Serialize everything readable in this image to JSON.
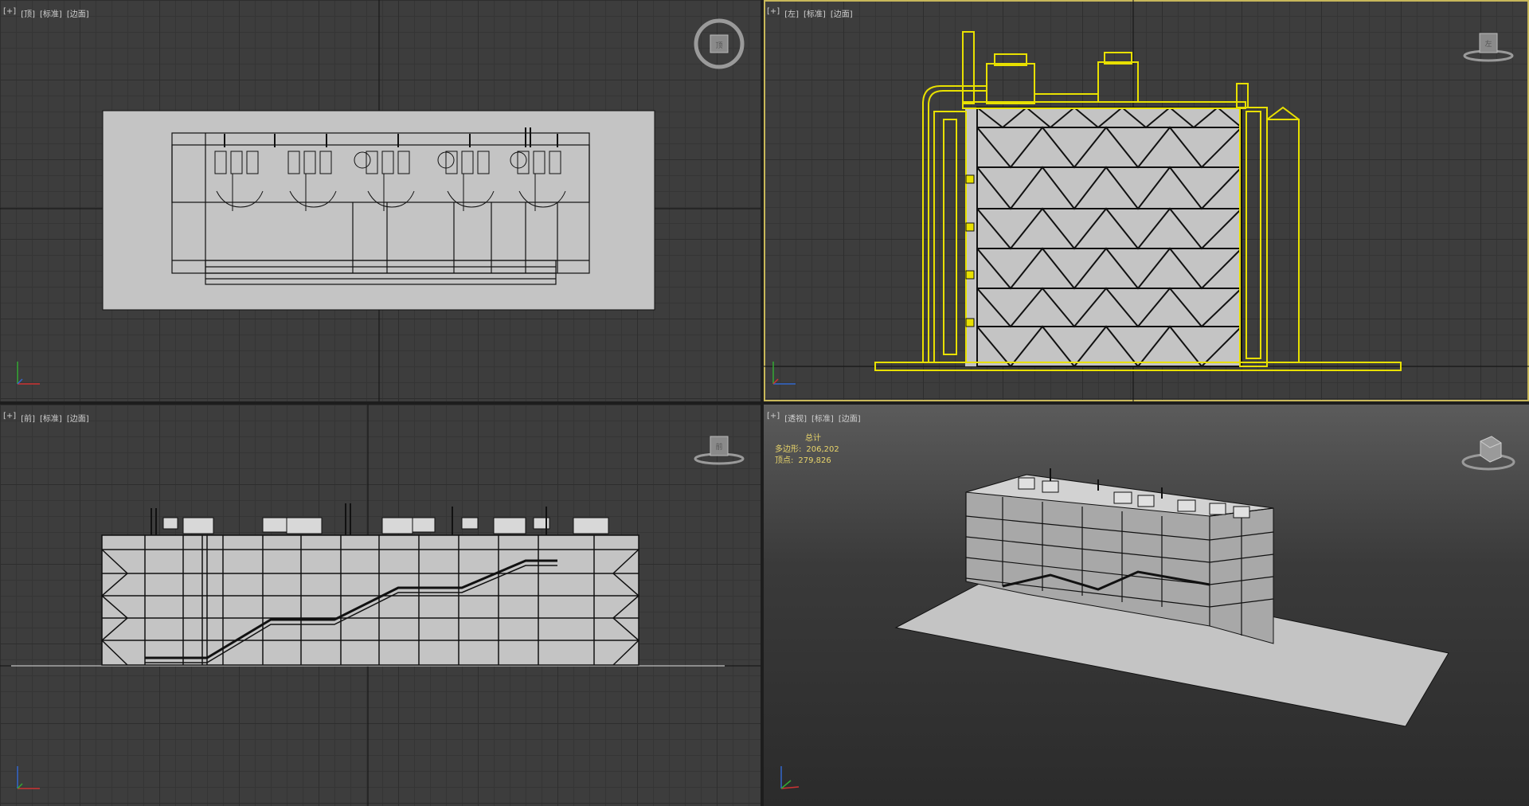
{
  "viewports": {
    "top": {
      "menu": "[+]",
      "view": "[顶]",
      "shading": "[标准]",
      "style": "[边面]"
    },
    "left": {
      "menu": "[+]",
      "view": "[左]",
      "shading": "[标准]",
      "style": "[边面]"
    },
    "front": {
      "menu": "[+]",
      "view": "[前]",
      "shading": "[标准]",
      "style": "[边面]"
    },
    "persp": {
      "menu": "[+]",
      "view": "[透视]",
      "shading": "[标准]",
      "style": "[边面]"
    }
  },
  "stats": {
    "title": "总计",
    "polys_label": "多边形:",
    "polys_value": "206,202",
    "verts_label": "顶点:",
    "verts_value": "279,826"
  },
  "viewcube_labels": {
    "top": "顶",
    "left": "左",
    "front": "前"
  },
  "colors": {
    "selection": "#e8e000",
    "stats_text": "#e8d46a",
    "active_border": "#c8b85a"
  }
}
